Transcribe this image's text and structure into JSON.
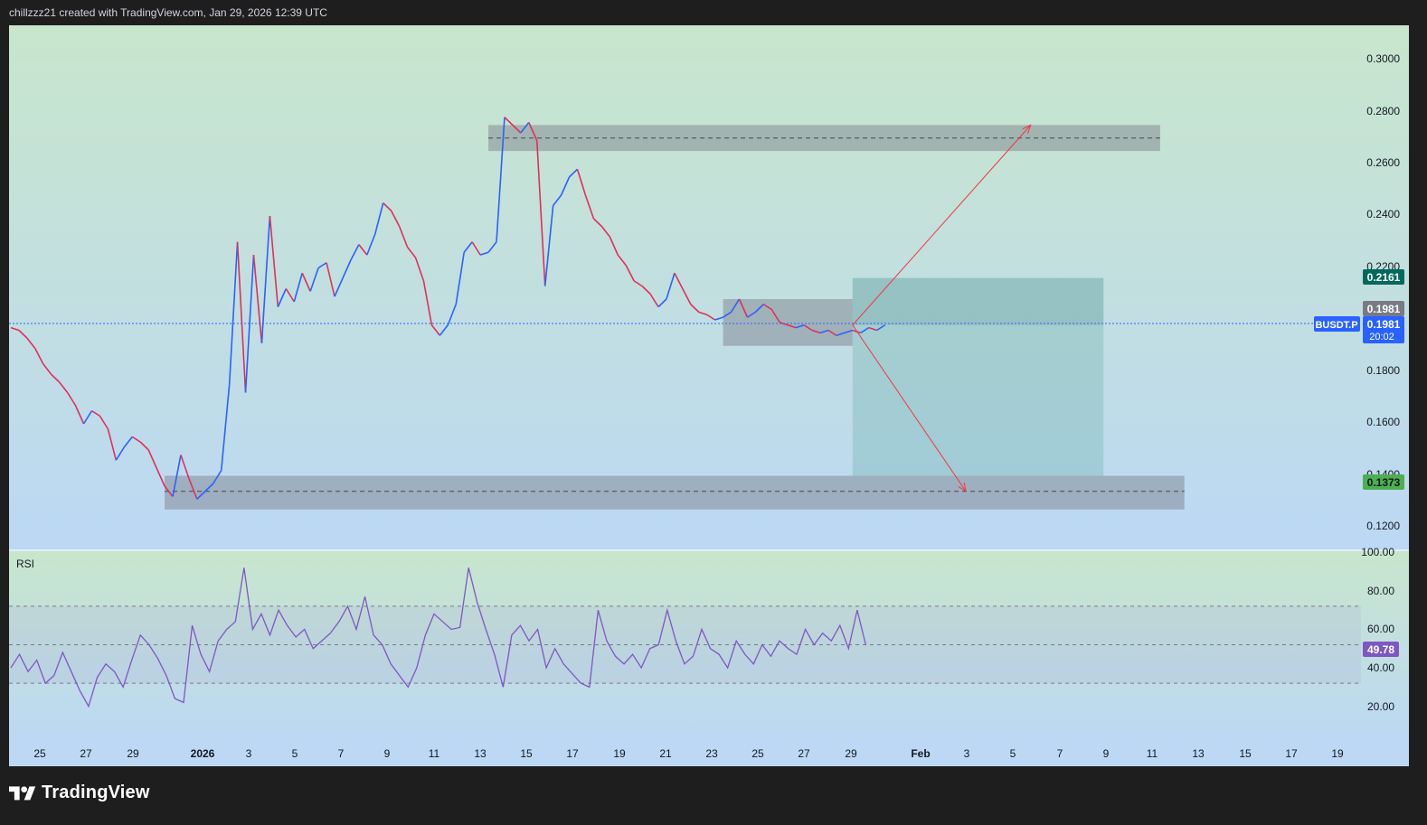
{
  "header": {
    "caption": "chillzzz21 created with TradingView.com, Jan 29, 2026 12:39 UTC"
  },
  "brand": {
    "name": "TradingView"
  },
  "colors": {
    "bg_top": "#c8e6cc",
    "bg_bottom": "#bcd8f4",
    "candle_up": "#2962ff",
    "candle_down": "#e0305a",
    "rsi_line": "#7e57c2",
    "zone": "#787b86",
    "target_box": "#4e9f94",
    "arrow": "#f23645",
    "crosshair": "#2962ff"
  },
  "price_axis": {
    "ticks": [
      "0.3000",
      "0.2800",
      "0.2600",
      "0.2400",
      "0.2200",
      "0.1800",
      "0.1600",
      "0.1400",
      "0.1200"
    ]
  },
  "price_labels": {
    "top": "0.2161",
    "last": "0.1981",
    "ticker": "BUSDT.P",
    "current": "0.1981",
    "countdown": "20:02",
    "bottom": "0.1373"
  },
  "rsi": {
    "label": "RSI",
    "ticks": [
      "100.00",
      "80.00",
      "60.00",
      "40.00",
      "20.00"
    ],
    "value": "49.78"
  },
  "time_axis": {
    "ticks": [
      "25",
      "27",
      "29",
      "2026",
      "3",
      "5",
      "7",
      "9",
      "11",
      "13",
      "15",
      "17",
      "19",
      "21",
      "23",
      "25",
      "27",
      "29",
      "Feb",
      "3",
      "5",
      "7",
      "9",
      "11",
      "13",
      "15",
      "17",
      "19"
    ]
  },
  "chart_data": {
    "type": "line",
    "title": "",
    "ylim": [
      0.115,
      0.305
    ],
    "rsi_ylim": [
      0,
      100
    ],
    "price_series": [
      [
        0,
        0.197
      ],
      [
        1,
        0.196
      ],
      [
        2,
        0.193
      ],
      [
        3,
        0.189
      ],
      [
        4,
        0.183
      ],
      [
        5,
        0.179
      ],
      [
        6,
        0.176
      ],
      [
        7,
        0.172
      ],
      [
        8,
        0.167
      ],
      [
        9,
        0.16
      ],
      [
        10,
        0.165
      ],
      [
        11,
        0.163
      ],
      [
        12,
        0.158
      ],
      [
        13,
        0.146
      ],
      [
        14,
        0.151
      ],
      [
        15,
        0.155
      ],
      [
        16,
        0.153
      ],
      [
        17,
        0.15
      ],
      [
        18,
        0.143
      ],
      [
        19,
        0.136
      ],
      [
        20,
        0.132
      ],
      [
        21,
        0.148
      ],
      [
        22,
        0.139
      ],
      [
        23,
        0.131
      ],
      [
        24,
        0.134
      ],
      [
        25,
        0.137
      ],
      [
        26,
        0.142
      ],
      [
        27,
        0.175
      ],
      [
        28,
        0.23
      ],
      [
        29,
        0.172
      ],
      [
        30,
        0.225
      ],
      [
        31,
        0.191
      ],
      [
        32,
        0.24
      ],
      [
        33,
        0.205
      ],
      [
        34,
        0.212
      ],
      [
        35,
        0.207
      ],
      [
        36,
        0.218
      ],
      [
        37,
        0.211
      ],
      [
        38,
        0.22
      ],
      [
        39,
        0.222
      ],
      [
        40,
        0.209
      ],
      [
        41,
        0.216
      ],
      [
        42,
        0.223
      ],
      [
        43,
        0.229
      ],
      [
        44,
        0.225
      ],
      [
        45,
        0.233
      ],
      [
        46,
        0.245
      ],
      [
        47,
        0.242
      ],
      [
        48,
        0.236
      ],
      [
        49,
        0.228
      ],
      [
        50,
        0.224
      ],
      [
        51,
        0.215
      ],
      [
        52,
        0.198
      ],
      [
        53,
        0.194
      ],
      [
        54,
        0.198
      ],
      [
        55,
        0.206
      ],
      [
        56,
        0.226
      ],
      [
        57,
        0.23
      ],
      [
        58,
        0.225
      ],
      [
        59,
        0.226
      ],
      [
        60,
        0.23
      ],
      [
        61,
        0.278
      ],
      [
        62,
        0.275
      ],
      [
        63,
        0.272
      ],
      [
        64,
        0.276
      ],
      [
        65,
        0.269
      ],
      [
        66,
        0.213
      ],
      [
        67,
        0.244
      ],
      [
        68,
        0.248
      ],
      [
        69,
        0.255
      ],
      [
        70,
        0.258
      ],
      [
        71,
        0.248
      ],
      [
        72,
        0.239
      ],
      [
        73,
        0.236
      ],
      [
        74,
        0.232
      ],
      [
        75,
        0.225
      ],
      [
        76,
        0.221
      ],
      [
        77,
        0.215
      ],
      [
        78,
        0.213
      ],
      [
        79,
        0.21
      ],
      [
        80,
        0.205
      ],
      [
        81,
        0.208
      ],
      [
        82,
        0.218
      ],
      [
        83,
        0.212
      ],
      [
        84,
        0.206
      ],
      [
        85,
        0.203
      ],
      [
        86,
        0.202
      ],
      [
        87,
        0.2
      ],
      [
        88,
        0.201
      ],
      [
        89,
        0.203
      ],
      [
        90,
        0.208
      ],
      [
        91,
        0.201
      ],
      [
        92,
        0.203
      ],
      [
        93,
        0.206
      ],
      [
        94,
        0.204
      ],
      [
        95,
        0.199
      ],
      [
        96,
        0.198
      ],
      [
        97,
        0.197
      ],
      [
        98,
        0.198
      ],
      [
        99,
        0.196
      ],
      [
        100,
        0.195
      ],
      [
        101,
        0.196
      ],
      [
        102,
        0.194
      ],
      [
        103,
        0.195
      ],
      [
        104,
        0.196
      ],
      [
        105,
        0.195
      ],
      [
        106,
        0.197
      ],
      [
        107,
        0.196
      ],
      [
        108,
        0.198
      ]
    ],
    "rsi_series": [
      [
        0,
        38
      ],
      [
        1,
        45
      ],
      [
        2,
        36
      ],
      [
        3,
        42
      ],
      [
        4,
        30
      ],
      [
        5,
        34
      ],
      [
        6,
        46
      ],
      [
        7,
        36
      ],
      [
        8,
        26
      ],
      [
        9,
        18
      ],
      [
        10,
        33
      ],
      [
        11,
        40
      ],
      [
        12,
        36
      ],
      [
        13,
        28
      ],
      [
        14,
        42
      ],
      [
        15,
        55
      ],
      [
        16,
        50
      ],
      [
        17,
        43
      ],
      [
        18,
        34
      ],
      [
        19,
        22
      ],
      [
        20,
        20
      ],
      [
        21,
        60
      ],
      [
        22,
        45
      ],
      [
        23,
        36
      ],
      [
        24,
        52
      ],
      [
        25,
        58
      ],
      [
        26,
        62
      ],
      [
        27,
        90
      ],
      [
        28,
        58
      ],
      [
        29,
        66
      ],
      [
        30,
        55
      ],
      [
        31,
        68
      ],
      [
        32,
        60
      ],
      [
        33,
        54
      ],
      [
        34,
        58
      ],
      [
        35,
        48
      ],
      [
        36,
        52
      ],
      [
        37,
        56
      ],
      [
        38,
        62
      ],
      [
        39,
        70
      ],
      [
        40,
        58
      ],
      [
        41,
        75
      ],
      [
        42,
        55
      ],
      [
        43,
        50
      ],
      [
        44,
        40
      ],
      [
        45,
        34
      ],
      [
        46,
        28
      ],
      [
        47,
        38
      ],
      [
        48,
        55
      ],
      [
        49,
        66
      ],
      [
        50,
        62
      ],
      [
        51,
        58
      ],
      [
        52,
        59
      ],
      [
        53,
        90
      ],
      [
        54,
        72
      ],
      [
        55,
        58
      ],
      [
        56,
        45
      ],
      [
        57,
        28
      ],
      [
        58,
        55
      ],
      [
        59,
        60
      ],
      [
        60,
        52
      ],
      [
        61,
        58
      ],
      [
        62,
        38
      ],
      [
        63,
        48
      ],
      [
        64,
        40
      ],
      [
        65,
        35
      ],
      [
        66,
        30
      ],
      [
        67,
        28
      ],
      [
        68,
        68
      ],
      [
        69,
        52
      ],
      [
        70,
        44
      ],
      [
        71,
        40
      ],
      [
        72,
        45
      ],
      [
        73,
        38
      ],
      [
        74,
        48
      ],
      [
        75,
        50
      ],
      [
        76,
        68
      ],
      [
        77,
        52
      ],
      [
        78,
        40
      ],
      [
        79,
        44
      ],
      [
        80,
        58
      ],
      [
        81,
        48
      ],
      [
        82,
        45
      ],
      [
        83,
        38
      ],
      [
        84,
        52
      ],
      [
        85,
        45
      ],
      [
        86,
        40
      ],
      [
        87,
        50
      ],
      [
        88,
        44
      ],
      [
        89,
        52
      ],
      [
        90,
        48
      ],
      [
        91,
        45
      ],
      [
        92,
        58
      ],
      [
        93,
        50
      ],
      [
        94,
        56
      ],
      [
        95,
        52
      ],
      [
        96,
        60
      ],
      [
        97,
        48
      ],
      [
        98,
        68
      ],
      [
        99,
        49.78
      ]
    ],
    "zones": [
      {
        "from_day": 59,
        "to_day": 142,
        "price_low": 0.265,
        "price_high": 0.275,
        "midline": 0.27
      },
      {
        "from_day": 19,
        "to_day": 145,
        "price_low": 0.127,
        "price_high": 0.14,
        "midline": 0.134
      },
      {
        "from_day": 88,
        "to_day": 104,
        "price_low": 0.19,
        "price_high": 0.208
      }
    ],
    "target_box": {
      "from_day": 104,
      "to_day": 135,
      "price_low": 0.14,
      "price_high": 0.2161
    },
    "arrows": [
      {
        "from_day": 104,
        "from_price": 0.198,
        "to_day": 126,
        "to_price": 0.275
      },
      {
        "from_day": 104,
        "from_price": 0.198,
        "to_day": 118,
        "to_price": 0.134
      }
    ]
  }
}
